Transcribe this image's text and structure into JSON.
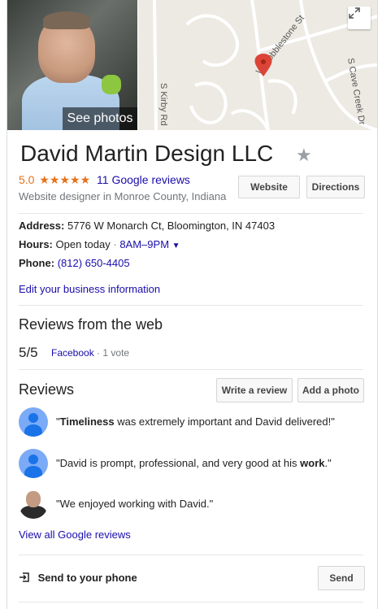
{
  "photo": {
    "see_photos": "See photos"
  },
  "map": {
    "streets": [
      "W Cobblestone St",
      "S Cave Creek Dr",
      "S Kirby Rd"
    ]
  },
  "business": {
    "name": "David Martin Design LLC",
    "rating": "5.0",
    "stars": "★★★★★",
    "reviews_link": "11 Google reviews",
    "category": "Website designer in Monroe County, Indiana"
  },
  "actions": {
    "website": "Website",
    "directions": "Directions"
  },
  "details": {
    "address_label": "Address:",
    "address_value": "5776 W Monarch Ct, Bloomington, IN 47403",
    "hours_label": "Hours:",
    "hours_status": "Open today",
    "hours_sep": "·",
    "hours_value": "8AM–9PM",
    "phone_label": "Phone:",
    "phone_value": "(812) 650-4405",
    "edit_link": "Edit your business information"
  },
  "web_reviews": {
    "heading": "Reviews from the web",
    "score": "5/5",
    "source": "Facebook",
    "sep": "·",
    "votes": "1 vote"
  },
  "reviews": {
    "heading": "Reviews",
    "write_review": "Write a review",
    "add_photo": "Add a photo",
    "items": [
      {
        "bold": "Timeliness",
        "before": "\"",
        "after": " was extremely important and David delivered!\""
      },
      {
        "before": "\"David is prompt, professional, and very good at his ",
        "bold": "work",
        "after": ".\""
      },
      {
        "before": "\"We enjoyed working with David.\"",
        "bold": "",
        "after": ""
      }
    ],
    "view_all": "View all Google reviews"
  },
  "send": {
    "label": "Send to your phone",
    "button": "Send"
  },
  "colors": {
    "link": "#1a0dab",
    "star": "#e7711b",
    "pin": "#db4437"
  }
}
